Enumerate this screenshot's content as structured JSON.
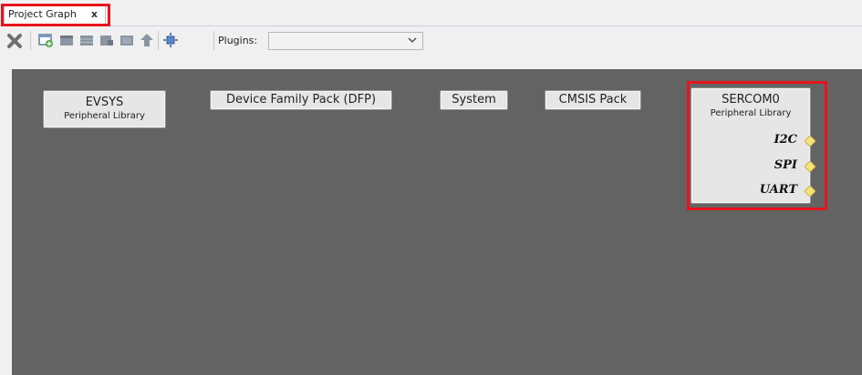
{
  "tab": {
    "label": "Project Graph",
    "close_label": "x"
  },
  "toolbar": {
    "plugins_label": "Plugins:",
    "plugins_value": "",
    "buttons": [
      "delete-icon",
      "new-component-icon",
      "folder-icon",
      "grid-icon",
      "group-icon",
      "module-icon",
      "up-arrow-icon",
      "fit-icon"
    ]
  },
  "graph": {
    "nodes": [
      {
        "title": "EVSYS",
        "subtitle": "Peripheral Library"
      },
      {
        "title": "Device Family Pack (DFP)"
      },
      {
        "title": "System"
      },
      {
        "title": "CMSIS Pack"
      },
      {
        "title": "SERCOM0",
        "subtitle": "Peripheral Library",
        "ports": [
          "I2C",
          "SPI",
          "UART"
        ]
      }
    ]
  },
  "colors": {
    "canvas": "#636363",
    "highlight": "#e8141c",
    "port_diamond": "#f7e37a"
  }
}
